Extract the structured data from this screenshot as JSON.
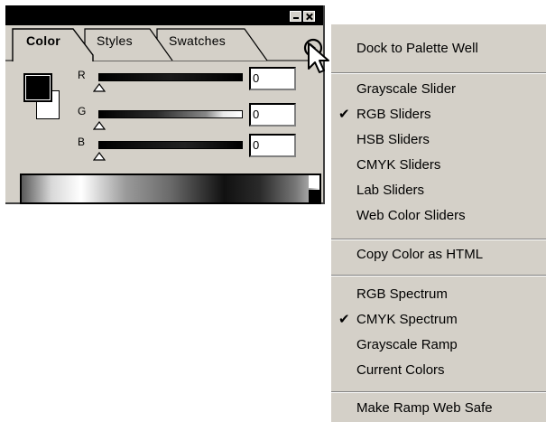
{
  "palette": {
    "tabs": [
      {
        "label": "Color",
        "active": true
      },
      {
        "label": "Styles",
        "active": false
      },
      {
        "label": "Swatches",
        "active": false
      }
    ],
    "channels": [
      {
        "name": "R",
        "value": "0"
      },
      {
        "name": "G",
        "value": "0"
      },
      {
        "name": "B",
        "value": "0"
      }
    ],
    "foreground_color": "#000000",
    "background_color": "#ffffff",
    "icons": {
      "menu_button": "circle-arrow-icon",
      "minimize": "minimize-icon",
      "close": "close-icon",
      "cursor": "mouse-pointer-icon"
    }
  },
  "menu": {
    "items": [
      {
        "label": "Dock to Palette Well",
        "checked": false
      },
      {
        "label": "Grayscale Slider",
        "checked": false
      },
      {
        "label": "RGB Sliders",
        "checked": true
      },
      {
        "label": "HSB Sliders",
        "checked": false
      },
      {
        "label": "CMYK Sliders",
        "checked": false
      },
      {
        "label": "Lab Sliders",
        "checked": false
      },
      {
        "label": "Web Color Sliders",
        "checked": false
      },
      {
        "label": "Copy Color as HTML",
        "checked": false
      },
      {
        "label": "RGB Spectrum",
        "checked": false
      },
      {
        "label": "CMYK Spectrum",
        "checked": true
      },
      {
        "label": "Grayscale Ramp",
        "checked": false
      },
      {
        "label": "Current Colors",
        "checked": false
      },
      {
        "label": "Make Ramp Web Safe",
        "checked": false
      }
    ],
    "check_glyph": "✔"
  }
}
